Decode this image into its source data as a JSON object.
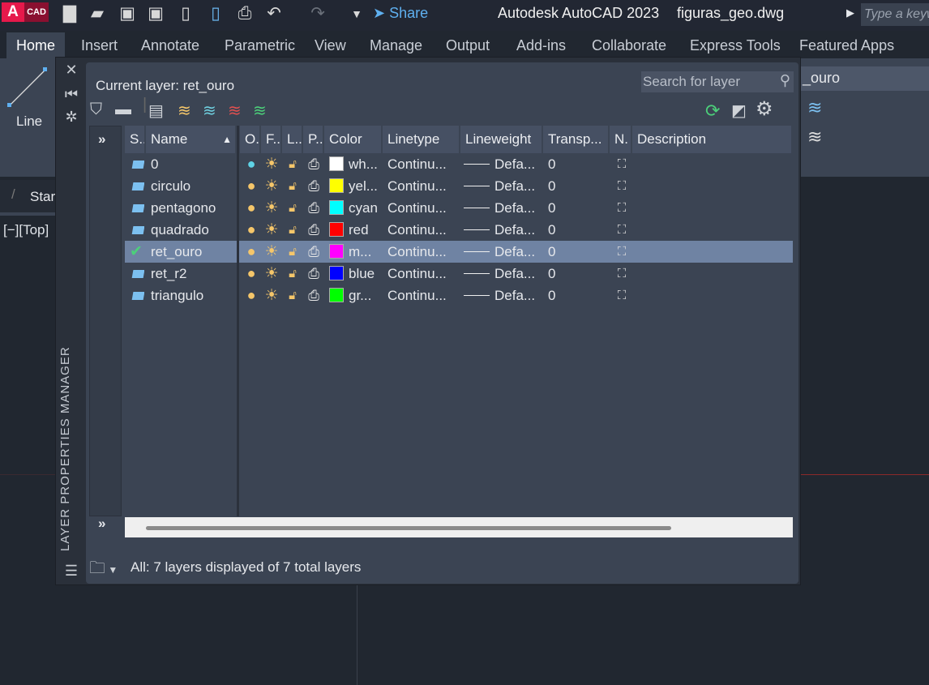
{
  "app": {
    "title": "Autodesk AutoCAD 2023",
    "file": "figuras_geo.dwg",
    "logo_letter": "A",
    "logo_text": "CAD",
    "share": "Share",
    "keyword_placeholder": "Type a keyword"
  },
  "tabs": [
    "Home",
    "Insert",
    "Annotate",
    "Parametric",
    "View",
    "Manage",
    "Output",
    "Add-ins",
    "Collaborate",
    "Express Tools",
    "Featured Apps"
  ],
  "ribbon": {
    "line_label": "Line",
    "layer_dropdown": "_ouro"
  },
  "drawing": {
    "tab_label": "Star",
    "view_label": "[−][Top]"
  },
  "palette": {
    "title": "LAYER PROPERTIES MANAGER",
    "current_layer": "Current layer: ret_ouro",
    "search_placeholder": "Search for layer",
    "columns": [
      "S..",
      "Name",
      "O.",
      "F..",
      "L..",
      "P..",
      "Color",
      "Linetype",
      "Lineweight",
      "Transp...",
      "N.",
      "Description"
    ],
    "rows": [
      {
        "name": "0",
        "color": "wh...",
        "swatch": "#ffffff",
        "linetype": "Continu...",
        "lineweight": "Defa...",
        "transparency": "0",
        "on_color": "#5fd3e6"
      },
      {
        "name": "circulo",
        "color": "yel...",
        "swatch": "#ffff00",
        "linetype": "Continu...",
        "lineweight": "Defa...",
        "transparency": "0",
        "on_color": "#f5c66a"
      },
      {
        "name": "pentagono",
        "color": "cyan",
        "swatch": "#00ffff",
        "linetype": "Continu...",
        "lineweight": "Defa...",
        "transparency": "0",
        "on_color": "#f5c66a"
      },
      {
        "name": "quadrado",
        "color": "red",
        "swatch": "#ff0000",
        "linetype": "Continu...",
        "lineweight": "Defa...",
        "transparency": "0",
        "on_color": "#f5c66a"
      },
      {
        "name": "ret_ouro",
        "color": "m...",
        "swatch": "#ff00ff",
        "linetype": "Continu...",
        "lineweight": "Defa...",
        "transparency": "0",
        "on_color": "#f5c66a",
        "current": true
      },
      {
        "name": "ret_r2",
        "color": "blue",
        "swatch": "#0000ff",
        "linetype": "Continu...",
        "lineweight": "Defa...",
        "transparency": "0",
        "on_color": "#f5c66a"
      },
      {
        "name": "triangulo",
        "color": "gr...",
        "swatch": "#00ff00",
        "linetype": "Continu...",
        "lineweight": "Defa...",
        "transparency": "0",
        "on_color": "#f5c66a"
      }
    ],
    "status": "All: 7 layers displayed of 7 total layers"
  }
}
